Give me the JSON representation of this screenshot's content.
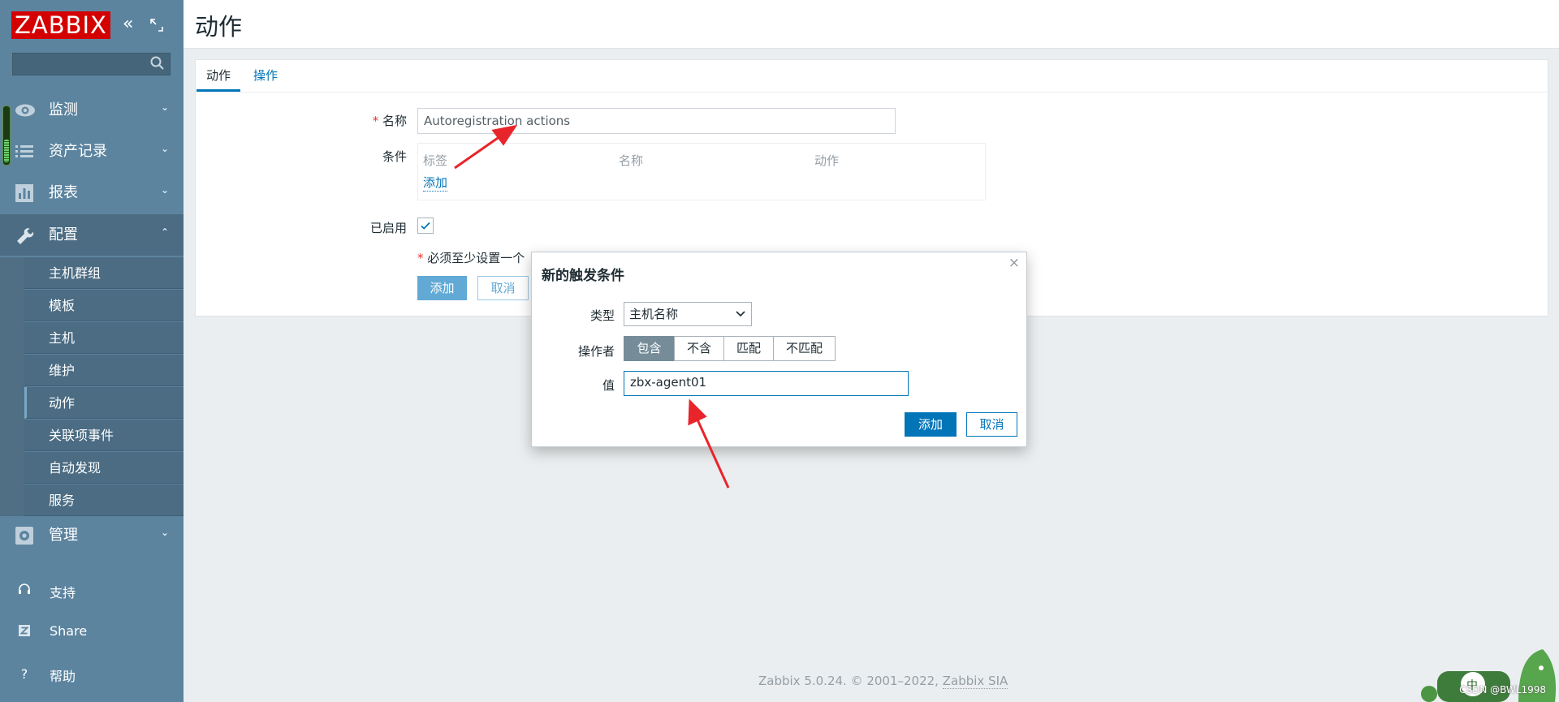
{
  "app": {
    "logo": "ZABBIX",
    "page_title": "动作"
  },
  "sidebar": {
    "search": {
      "placeholder": "",
      "value": ""
    },
    "menu": [
      {
        "label": "监测",
        "icon": "eye-icon"
      },
      {
        "label": "资产记录",
        "icon": "list-icon"
      },
      {
        "label": "报表",
        "icon": "bar-chart-icon"
      },
      {
        "label": "配置",
        "icon": "wrench-icon"
      },
      {
        "label": "管理",
        "icon": "gear-icon"
      }
    ],
    "config_sub": [
      "主机群组",
      "模板",
      "主机",
      "维护",
      "动作",
      "关联项事件",
      "自动发现",
      "服务"
    ],
    "bottom": [
      {
        "label": "支持",
        "icon": "headset-icon"
      },
      {
        "label": "Share",
        "icon": "share-z-icon"
      },
      {
        "label": "帮助",
        "icon": "help-icon"
      }
    ]
  },
  "tabs": {
    "action": "动作",
    "operations": "操作"
  },
  "form": {
    "name_label": "名称",
    "name_value": "Autoregistration actions",
    "conditions_label": "条件",
    "cond_headers": [
      "标签",
      "名称",
      "动作"
    ],
    "cond_add": "添加",
    "enabled_label": "已启用",
    "enabled": true,
    "required_note": "必须至少设置一个",
    "add_button": "添加",
    "cancel_button": "取消"
  },
  "dialog": {
    "title": "新的触发条件",
    "close": "×",
    "type_label": "类型",
    "type_value": "主机名称",
    "operator_label": "操作者",
    "operators": [
      "包含",
      "不含",
      "匹配",
      "不匹配"
    ],
    "operator_selected": "包含",
    "value_label": "值",
    "value": "zbx-agent01",
    "add_button": "添加",
    "cancel_button": "取消"
  },
  "footer": {
    "text": "Zabbix 5.0.24. © 2001–2022, ",
    "link": "Zabbix SIA"
  },
  "watermark": "CSDN @BWL1998",
  "colors": {
    "sidebar": "#5c849f",
    "brand_red": "#d40000",
    "link_blue": "#0275b8",
    "annotation_red": "#e8252b"
  }
}
